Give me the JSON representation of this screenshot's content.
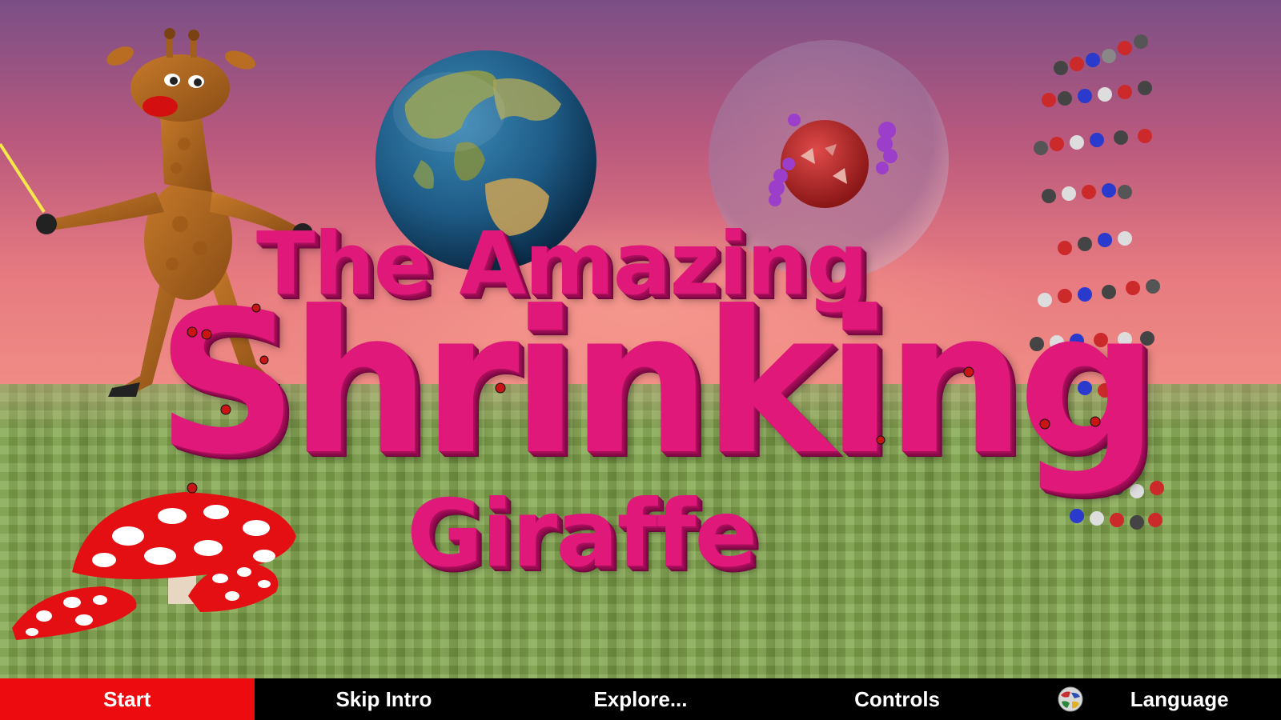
{
  "title": {
    "line1": "The Amazing",
    "line2": "Shrinking",
    "line3": "Giraffe"
  },
  "menu": {
    "items": [
      {
        "label": "Start",
        "active": true
      },
      {
        "label": "Skip Intro",
        "active": false
      },
      {
        "label": "Explore...",
        "active": false
      },
      {
        "label": "Controls",
        "active": false
      },
      {
        "label": "Language",
        "active": false,
        "icon": "globe-icon"
      }
    ]
  },
  "colors": {
    "title": "#e0187a",
    "active_button": "#ee0b10",
    "menu_background": "#000000",
    "sky_top": "#7a4f86",
    "sky_bottom": "#f08d85",
    "ground": "#7fa049"
  },
  "scene_objects": [
    "giraffe-character",
    "earth-globe",
    "cell-sphere",
    "dna-helix",
    "mushrooms",
    "ladybugs"
  ]
}
